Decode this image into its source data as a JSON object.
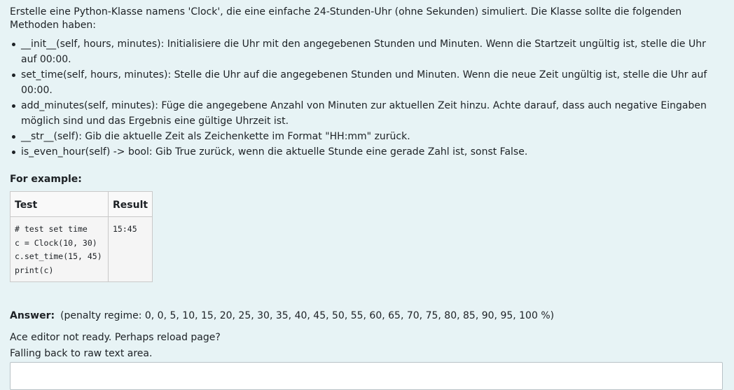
{
  "question": {
    "intro": "Erstelle eine Python-Klasse namens 'Clock', die eine einfache 24-Stunden-Uhr (ohne Sekunden) simuliert. Die Klasse sollte die folgenden Methoden haben:",
    "methods": [
      "__init__(self, hours, minutes): Initialisiere die Uhr mit den angegebenen Stunden und Minuten. Wenn die Startzeit ungültig ist, stelle die Uhr auf 00:00.",
      "set_time(self, hours, minutes): Stelle die Uhr auf die angegebenen Stunden und Minuten. Wenn die neue Zeit ungültig ist, stelle die Uhr auf 00:00.",
      "add_minutes(self, minutes): Füge die angegebene Anzahl von Minuten zur aktuellen Zeit hinzu. Achte darauf, dass auch negative Eingaben möglich sind und das Ergebnis eine gültige Uhrzeit ist.",
      "__str__(self): Gib die aktuelle Zeit als Zeichenkette im Format \"HH:mm\" zurück.",
      "is_even_hour(self) -> bool: Gib True zurück, wenn die aktuelle Stunde eine gerade Zahl ist, sonst False."
    ]
  },
  "examples": {
    "heading": "For example:",
    "columns": [
      "Test",
      "Result"
    ],
    "rows": [
      {
        "test": "# test set time\nc = Clock(10, 30)\nc.set_time(15, 45)\nprint(c)",
        "result": "15:45"
      }
    ]
  },
  "answer": {
    "label": "Answer:",
    "penalty": "(penalty regime: 0, 0, 5, 10, 15, 20, 25, 30, 35, 40, 45, 50, 55, 60, 65, 70, 75, 80, 85, 90, 95, 100 %)",
    "notice_line1": "Ace editor not ready. Perhaps reload page?",
    "notice_line2": "Falling back to raw text area.",
    "value": ""
  }
}
